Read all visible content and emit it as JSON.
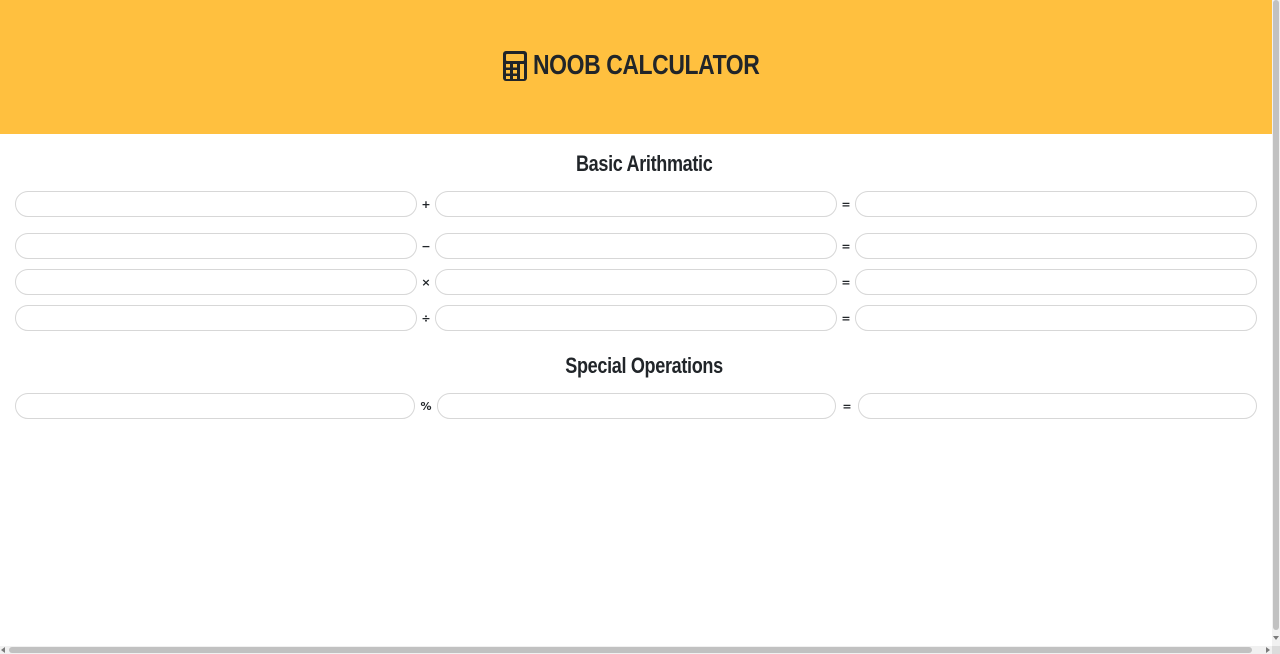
{
  "header": {
    "title": "NOOB CALCULATOR",
    "icon": "calculator-icon",
    "background": "#ffc03f"
  },
  "sections": {
    "basic": {
      "title": "Basic Arithmatic"
    },
    "special": {
      "title": "Special Operations"
    }
  },
  "operators": {
    "add": "+",
    "subtract": "−",
    "multiply": "×",
    "divide": "÷",
    "percent": "%",
    "equals": "="
  },
  "fields": {
    "add_a": "",
    "add_b": "",
    "add_result": "",
    "sub_a": "",
    "sub_b": "",
    "sub_result": "",
    "mul_a": "",
    "mul_b": "",
    "mul_result": "",
    "div_a": "",
    "div_b": "",
    "div_result": "",
    "pct_a": "",
    "pct_b": "",
    "pct_result": ""
  }
}
